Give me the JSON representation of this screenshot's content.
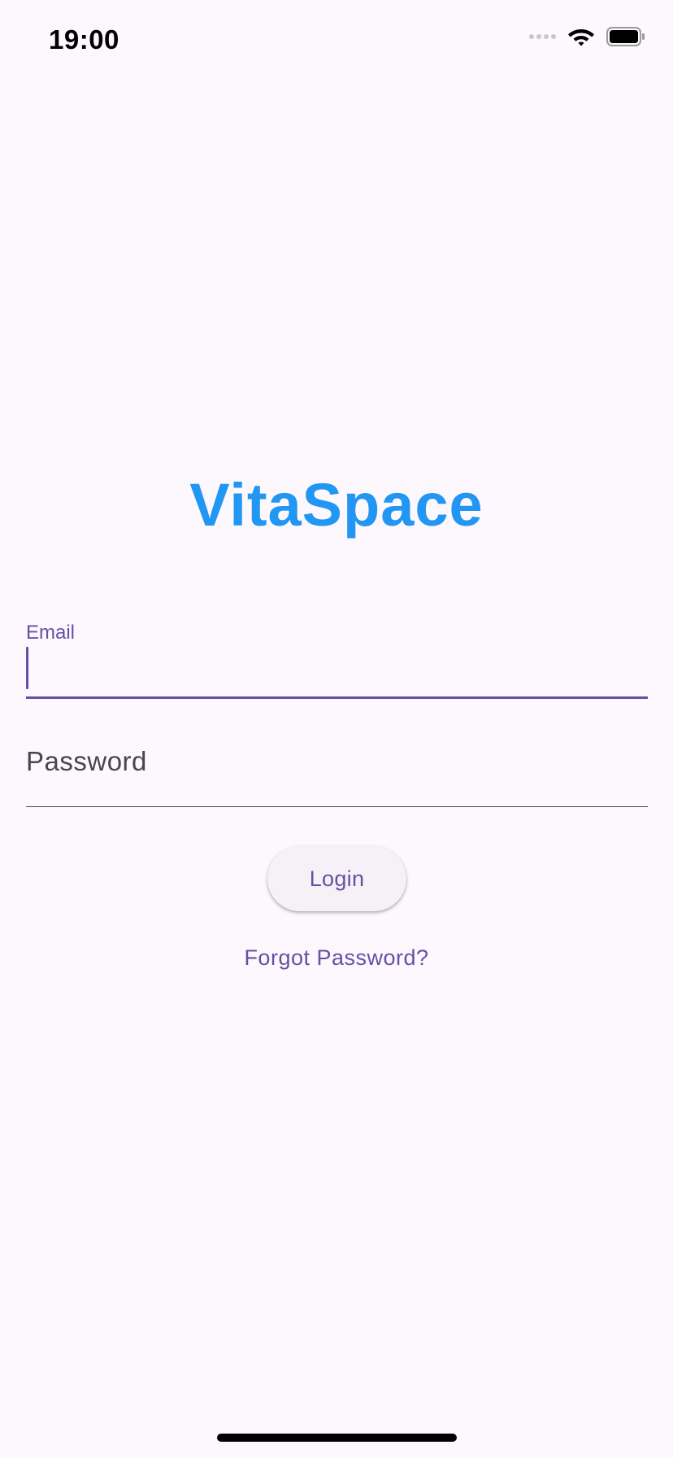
{
  "status_bar": {
    "time": "19:00"
  },
  "app": {
    "title": "VitaSpace"
  },
  "form": {
    "email_label": "Email",
    "email_value": "",
    "password_label": "Password",
    "password_value": "",
    "login_label": "Login",
    "forgot_label": "Forgot Password?"
  },
  "colors": {
    "title": "#2196f3",
    "accent": "#6750a4",
    "background": "#fdf7fe"
  },
  "icons": [
    "cellular-signal-icon",
    "wifi-icon",
    "battery-icon"
  ]
}
